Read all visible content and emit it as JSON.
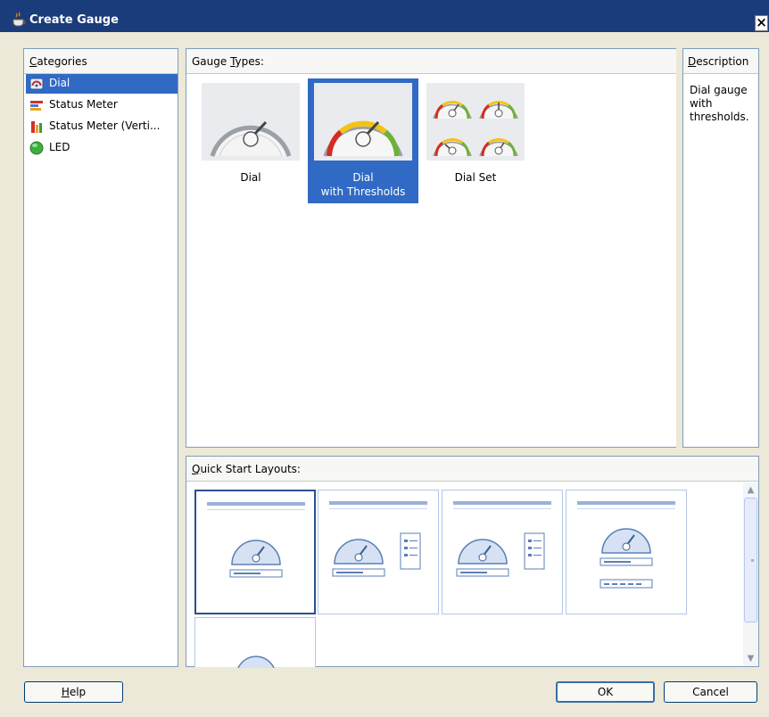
{
  "window": {
    "title": "Create Gauge",
    "close_label": "×"
  },
  "categories": {
    "header": "Categories",
    "items": [
      {
        "label": "Dial",
        "icon": "dial-icon",
        "selected": true
      },
      {
        "label": "Status Meter",
        "icon": "status-meter-icon",
        "selected": false
      },
      {
        "label": "Status Meter (Verti...",
        "icon": "status-meter-vertical-icon",
        "selected": false
      },
      {
        "label": "LED",
        "icon": "led-icon",
        "selected": false
      }
    ]
  },
  "gauge_types": {
    "header": "Gauge Types:",
    "items": [
      {
        "label": "Dial",
        "selected": false
      },
      {
        "label": "Dial\nwith Thresholds",
        "line1": "Dial",
        "line2": "with Thresholds",
        "selected": true
      },
      {
        "label": "Dial Set",
        "selected": false
      }
    ]
  },
  "description": {
    "header": "Description",
    "text": "Dial gauge with thresholds."
  },
  "quick_start": {
    "header": "Quick Start Layouts:",
    "layouts": [
      {
        "id": "layout-1",
        "selected": true
      },
      {
        "id": "layout-2",
        "selected": false
      },
      {
        "id": "layout-3",
        "selected": false
      },
      {
        "id": "layout-4",
        "selected": false
      },
      {
        "id": "layout-5",
        "selected": false
      }
    ]
  },
  "buttons": {
    "help": "Help",
    "ok": "OK",
    "cancel": "Cancel"
  },
  "colors": {
    "selection": "#316ac5",
    "titlebar": "#1b3c7a",
    "dialog_bg": "#ece9d8"
  }
}
